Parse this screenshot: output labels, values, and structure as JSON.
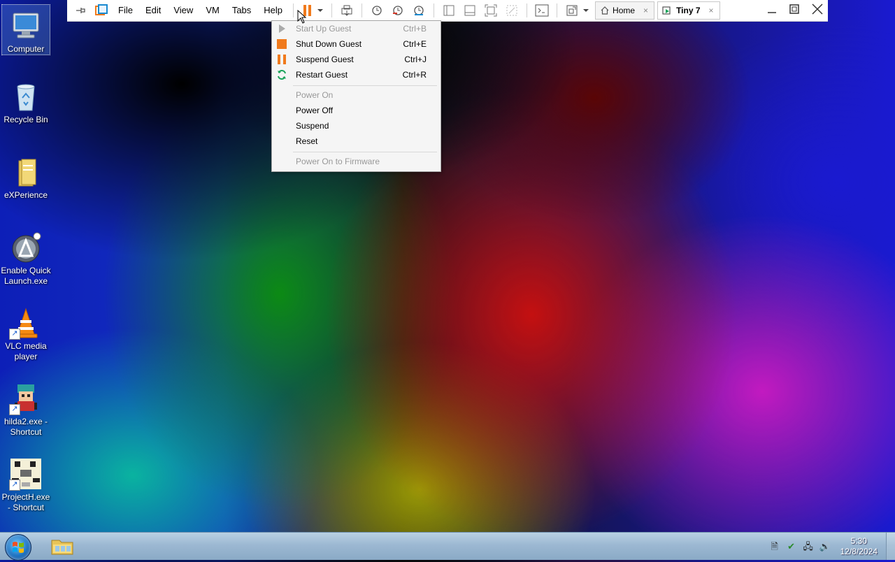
{
  "desktop_icons": [
    {
      "label": "Computer"
    },
    {
      "label": "Recycle Bin"
    },
    {
      "label": "eXPerience"
    },
    {
      "label": "Enable Quick Launch.exe"
    },
    {
      "label": "VLC media player"
    },
    {
      "label": "hilda2.exe - Shortcut"
    },
    {
      "label": "ProjectH.exe - Shortcut"
    }
  ],
  "vm_toolbar": {
    "menus": [
      "File",
      "Edit",
      "View",
      "VM",
      "Tabs",
      "Help"
    ],
    "tabs": [
      {
        "label": "Home",
        "close": "×"
      },
      {
        "label": "Tiny 7",
        "close": "×"
      }
    ],
    "colors": {
      "accent_pause": "#f07a1c",
      "stop": "#f07a1c",
      "restart": "#1aa35a"
    }
  },
  "power_menu": {
    "items": [
      {
        "label": "Start Up Guest",
        "shortcut": "Ctrl+B",
        "disabled": true,
        "icon": "play-icon"
      },
      {
        "label": "Shut Down Guest",
        "shortcut": "Ctrl+E",
        "disabled": false,
        "icon": "stop-icon"
      },
      {
        "label": "Suspend Guest",
        "shortcut": "Ctrl+J",
        "disabled": false,
        "icon": "pause-icon"
      },
      {
        "label": "Restart Guest",
        "shortcut": "Ctrl+R",
        "disabled": false,
        "icon": "restart-icon"
      },
      {
        "label": "Power On",
        "shortcut": "",
        "disabled": true
      },
      {
        "label": "Power Off",
        "shortcut": "",
        "disabled": false
      },
      {
        "label": "Suspend",
        "shortcut": "",
        "disabled": false
      },
      {
        "label": "Reset",
        "shortcut": "",
        "disabled": false
      },
      {
        "label": "Power On to Firmware",
        "shortcut": "",
        "disabled": true
      }
    ]
  },
  "taskbar": {
    "clock_time": "5:30",
    "clock_date": "12/8/2024"
  }
}
